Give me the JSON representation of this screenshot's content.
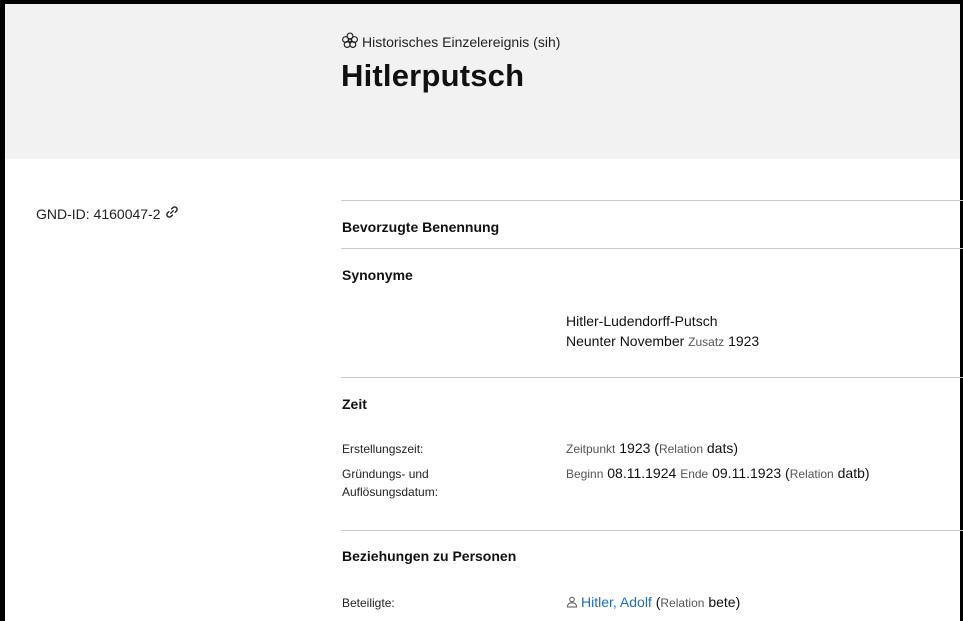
{
  "header": {
    "entity_type": "Historisches Einzelereignis (sih)",
    "title": "Hitlerputsch",
    "type_icon": "event-icon"
  },
  "gnd": {
    "label": "GND-ID: 4160047-2",
    "link_icon": "link-icon"
  },
  "sections": {
    "preferred": {
      "heading": "Bevorzugte Benennung"
    },
    "synonyms": {
      "heading": "Synonyme",
      "line1": "Hitler-Ludendorff-Putsch",
      "line2_text": "Neunter November",
      "line2_qual": "Zusatz",
      "line2_val": "1923"
    },
    "time": {
      "heading": "Zeit",
      "row1": {
        "label": "Erstellungszeit:",
        "q1": "Zeitpunkt",
        "v1": "1923",
        "open": "(",
        "rel": "Relation",
        "code": "dats",
        "close": ")"
      },
      "row2": {
        "label_line1": "Gründungs- und",
        "label_line2": "Auflösungsdatum:",
        "q1": "Beginn",
        "v1": "08.11.1924",
        "q2": "Ende",
        "v2": "09.11.1923",
        "open": "(",
        "rel": "Relation",
        "code": "datb",
        "close": ")"
      }
    },
    "persons": {
      "heading": "Beziehungen zu Personen",
      "row1": {
        "label": "Beteiligte:",
        "name": "Hitler, Adolf",
        "open": "(",
        "rel": "Relation",
        "code": "bete",
        "close": ")"
      }
    }
  },
  "colors": {
    "link": "#1f6fbf",
    "header_bg": "#f2f2f2",
    "rule": "#c9c9c9"
  }
}
